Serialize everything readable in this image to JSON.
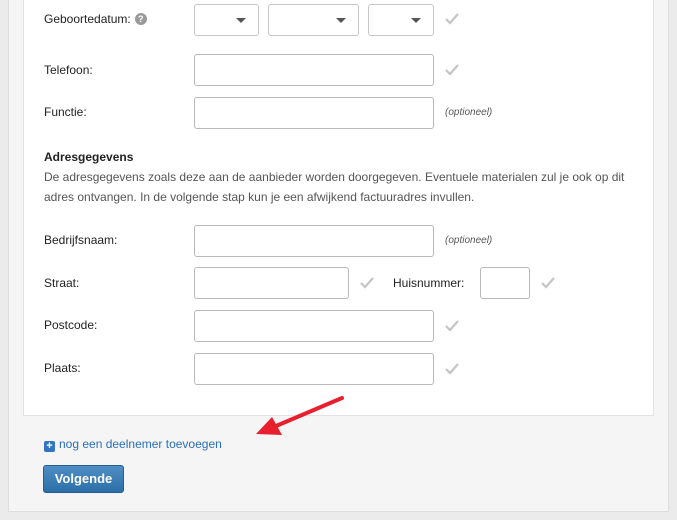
{
  "form": {
    "birthdate": {
      "label": "Geboortedatum:",
      "help_icon": "?"
    },
    "phone": {
      "label": "Telefoon:"
    },
    "function": {
      "label": "Functie:",
      "optional": "(optioneel)"
    }
  },
  "address": {
    "title": "Adresgegevens",
    "description": "De adresgegevens zoals deze aan de aanbieder worden doorgegeven. Eventuele materialen zul je ook op dit adres ontvangen. In de volgende stap kun je een afwijkend factuuradres invullen.",
    "company": {
      "label": "Bedrijfsnaam:",
      "optional": "(optioneel)"
    },
    "street": {
      "label": "Straat:"
    },
    "house_number": {
      "label": "Huisnummer:"
    },
    "postcode": {
      "label": "Postcode:"
    },
    "city": {
      "label": "Plaats:"
    }
  },
  "actions": {
    "add_participant": "nog een deelnemer toevoegen",
    "next": "Volgende"
  },
  "colors": {
    "link": "#2a6eb8",
    "button": "#2c6fa8",
    "annotation_arrow": "#e8202e",
    "checkmark": "#c4c4c4"
  },
  "icons": [
    "help-icon",
    "chevron-down-icon",
    "checkmark-icon",
    "plus-icon",
    "annotation-arrow"
  ]
}
